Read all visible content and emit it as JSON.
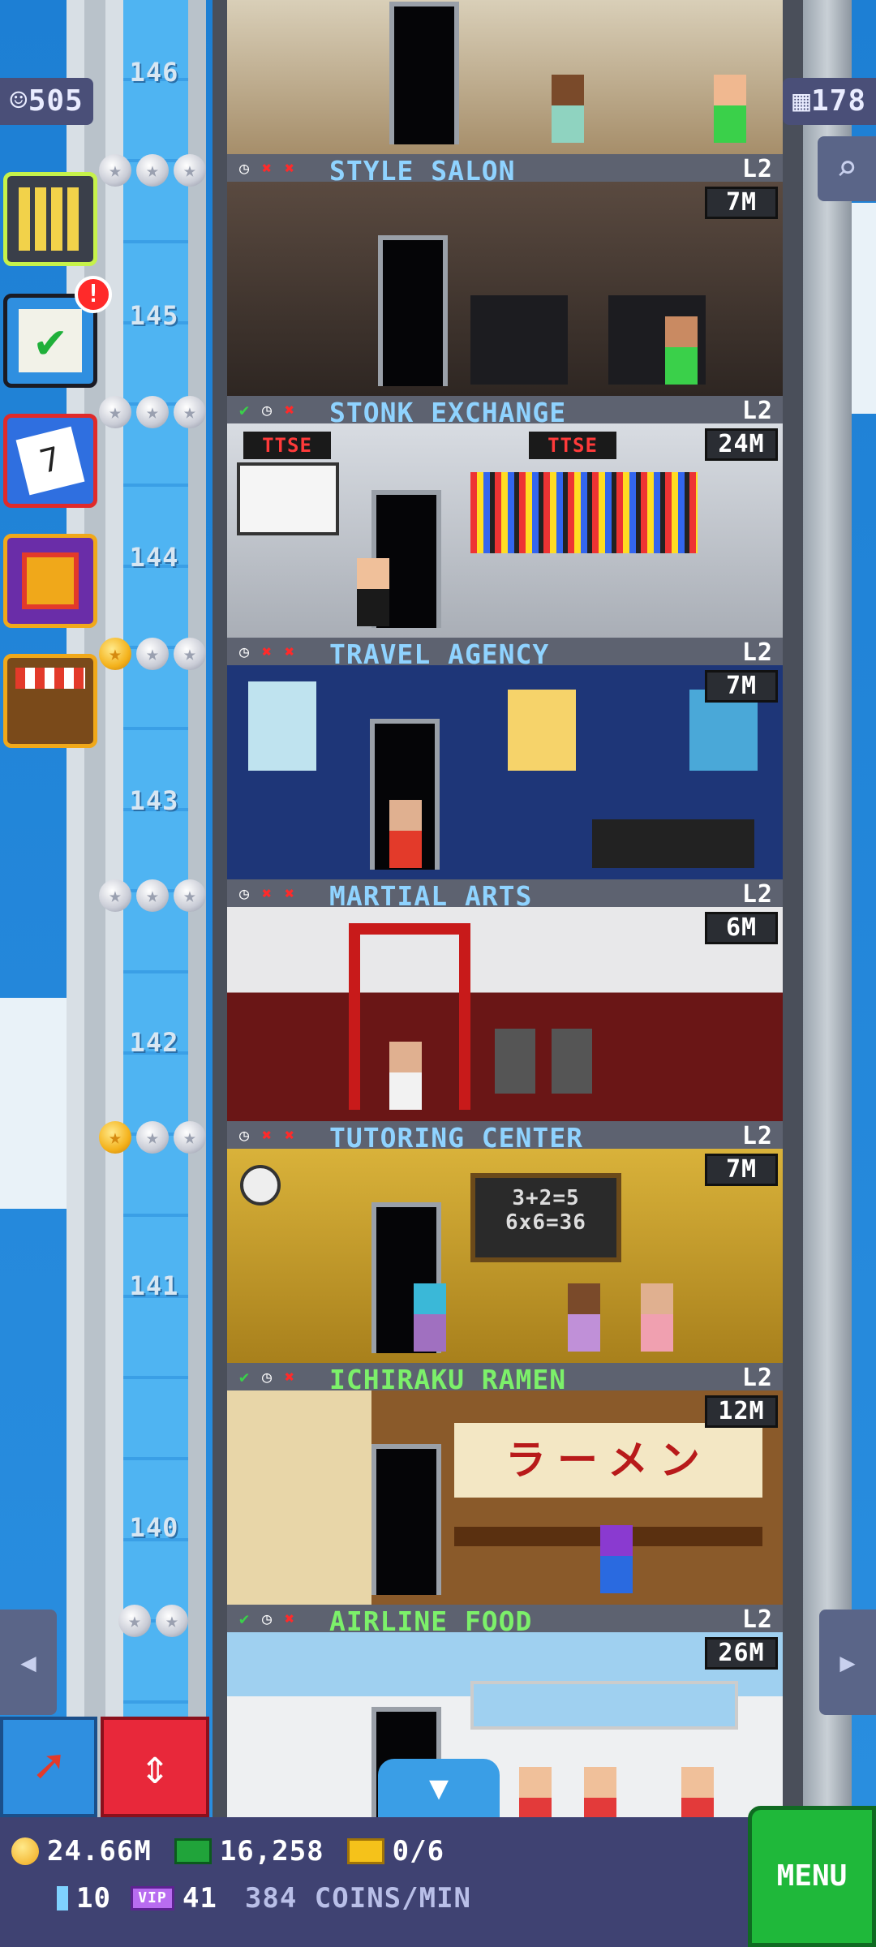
{
  "counters": {
    "population": "505",
    "floors": "178"
  },
  "floor_numbers": [
    "146",
    "145",
    "144",
    "143",
    "142",
    "141",
    "140"
  ],
  "floors": [
    {
      "name": "STYLE SALON",
      "level": "L2",
      "stock": "7M",
      "status": [
        "clock",
        "cross",
        "cross"
      ],
      "name_color": "blue"
    },
    {
      "name": "STONK EXCHANGE",
      "level": "L2",
      "stock": "24M",
      "status": [
        "check",
        "clock",
        "cross"
      ],
      "name_color": "blue",
      "signs": [
        "TTSE",
        "TTSE"
      ]
    },
    {
      "name": "TRAVEL AGENCY",
      "level": "L2",
      "stock": "7M",
      "status": [
        "clock",
        "cross",
        "cross"
      ],
      "name_color": "blue"
    },
    {
      "name": "MARTIAL ARTS",
      "level": "L2",
      "stock": "6M",
      "status": [
        "clock",
        "cross",
        "cross"
      ],
      "name_color": "blue"
    },
    {
      "name": "TUTORING CENTER",
      "level": "L2",
      "stock": "7M",
      "status": [
        "clock",
        "cross",
        "cross"
      ],
      "name_color": "blue",
      "chalkboard": [
        "3+2=5",
        "6x6=36"
      ]
    },
    {
      "name": "ICHIRAKU RAMEN",
      "level": "L2",
      "stock": "12M",
      "status": [
        "check",
        "clock",
        "cross"
      ],
      "name_color": "green",
      "sign": "ラーメン"
    },
    {
      "name": "AIRLINE FOOD",
      "level": "L2",
      "stock": "26M",
      "status": [
        "check",
        "clock",
        "cross"
      ],
      "name_color": "green"
    }
  ],
  "stars": [
    {
      "gold": 0,
      "total": 3
    },
    {
      "gold": 0,
      "total": 3
    },
    {
      "gold": 1,
      "total": 3
    },
    {
      "gold": 0,
      "total": 3
    },
    {
      "gold": 1,
      "total": 3
    },
    {
      "gold": 0,
      "total": 2
    }
  ],
  "side_buttons": [
    {
      "name": "building-icon",
      "color": "#3a3f4a",
      "border": "#c6f24a"
    },
    {
      "name": "missions-icon",
      "color": "#2f8fe0",
      "border": "#1b1b24",
      "badge": "!"
    },
    {
      "name": "calendar-icon",
      "color": "#2f6fe0",
      "border": "#e02a2a",
      "label": "7"
    },
    {
      "name": "gift-icon",
      "color": "#6a2da8",
      "border": "#f0a81a"
    },
    {
      "name": "shop-icon",
      "color": "#7a4a1a",
      "border": "#f0a81a"
    }
  ],
  "hud": {
    "coins": "24.66M",
    "bux": "16,258",
    "tickets": "0/6",
    "gems": "10",
    "vip": "41",
    "rate": "384 COINS/MIN",
    "menu": "MENU"
  },
  "icons": {
    "clock": "◷",
    "check": "✔",
    "cross": "✖",
    "up_down": "⇕",
    "down": "▼",
    "search": "⌕",
    "left": "◀",
    "right": "▶"
  }
}
